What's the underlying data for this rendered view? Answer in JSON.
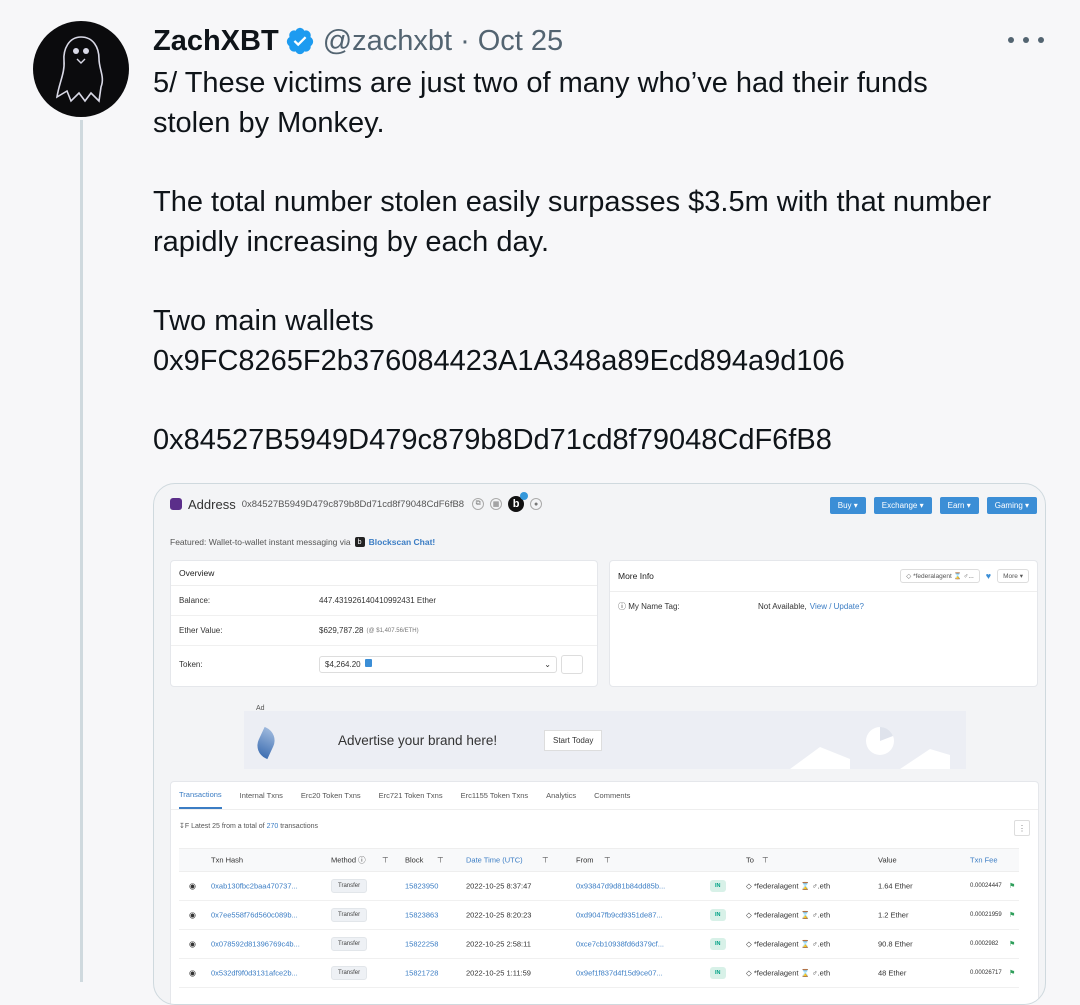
{
  "tweet": {
    "author": "ZachXBT",
    "handle": "@zachxbt",
    "separator": "·",
    "date": "Oct 25",
    "lines": [
      "5/ These victims are just two of many who’ve had their funds",
      "stolen by Monkey.",
      "The total number stolen easily surpasses $3.5m with that number",
      "rapidly increasing by each day.",
      "Two main wallets",
      "0x9FC8265F2b376084423A1A348a89Ecd894a9d106",
      "0x84527B5949D479c879b8Dd71cd8f79048CdF6fB8"
    ]
  },
  "colors": {
    "verified": "#1d9bf0",
    "link": "#3b7dc4",
    "menu": "#3b8ed6",
    "in_badge": "#00a186"
  },
  "etherscan": {
    "title": "Address",
    "address": "0x84527B5949D479c879b8Dd71cd8f79048CdF6fB8",
    "b_icon": "b",
    "menu": [
      "Buy ▾",
      "Exchange ▾",
      "Earn ▾",
      "Gaming ▾"
    ],
    "featured_prefix": "Featured: Wallet-to-wallet instant messaging via",
    "featured_link": "Blockscan Chat!",
    "overview": {
      "header": "Overview",
      "balance_label": "Balance:",
      "balance_value": "447.431926140410992431 Ether",
      "ether_value_label": "Ether Value:",
      "ether_value": "$629,787.28",
      "ether_value_sub": "(@ $1,407.56/ETH)",
      "token_label": "Token:",
      "token_value": "$4,264.20"
    },
    "more_info": {
      "header": "More Info",
      "tag_pill": "◇ *federalagent ⌛ ♂...",
      "more_pill": "More ▾",
      "name_tag_label": "ⓘ My Name Tag:",
      "name_tag_value": "Not Available,",
      "name_tag_link": "View / Update?"
    },
    "ad": {
      "label": "Ad",
      "text": "Advertise your brand here!",
      "button": "Start Today"
    },
    "tabs": [
      "Transactions",
      "Internal Txns",
      "Erc20 Token Txns",
      "Erc721 Token Txns",
      "Erc1155 Token Txns",
      "Analytics",
      "Comments"
    ],
    "latest_prefix": "↧F Latest 25 from a total of",
    "latest_count": "270",
    "latest_suffix": "transactions",
    "columns": {
      "hash": "Txn Hash",
      "method": "Method ⓘ",
      "block": "Block",
      "time": "Date Time (UTC)",
      "from": "From",
      "to": "To",
      "value": "Value",
      "fee": "Txn Fee"
    },
    "rows": [
      {
        "hash": "0xab130fbc2baa470737...",
        "method": "Transfer",
        "block": "15823950",
        "time": "2022-10-25 8:37:47",
        "from": "0x93847d9d81b84dd85b...",
        "dir": "IN",
        "to": "◇ *federalagent ⌛ ♂.eth",
        "value": "1.64 Ether",
        "fee": "0.00024447"
      },
      {
        "hash": "0x7ee558f76d560c089b...",
        "method": "Transfer",
        "block": "15823863",
        "time": "2022-10-25 8:20:23",
        "from": "0xd9047fb9cd9351de87...",
        "dir": "IN",
        "to": "◇ *federalagent ⌛ ♂.eth",
        "value": "1.2 Ether",
        "fee": "0.00021959"
      },
      {
        "hash": "0x078592d81396769c4b...",
        "method": "Transfer",
        "block": "15822258",
        "time": "2022-10-25 2:58:11",
        "from": "0xce7cb10938fd6d379cf...",
        "dir": "IN",
        "to": "◇ *federalagent ⌛ ♂.eth",
        "value": "90.8 Ether",
        "fee": "0.0002982"
      },
      {
        "hash": "0x532df9f0d3131afce2b...",
        "method": "Transfer",
        "block": "15821728",
        "time": "2022-10-25 1:11:59",
        "from": "0x9ef1f837d4f15d9ce07...",
        "dir": "IN",
        "to": "◇ *federalagent ⌛ ♂.eth",
        "value": "48 Ether",
        "fee": "0.00026717"
      }
    ]
  }
}
